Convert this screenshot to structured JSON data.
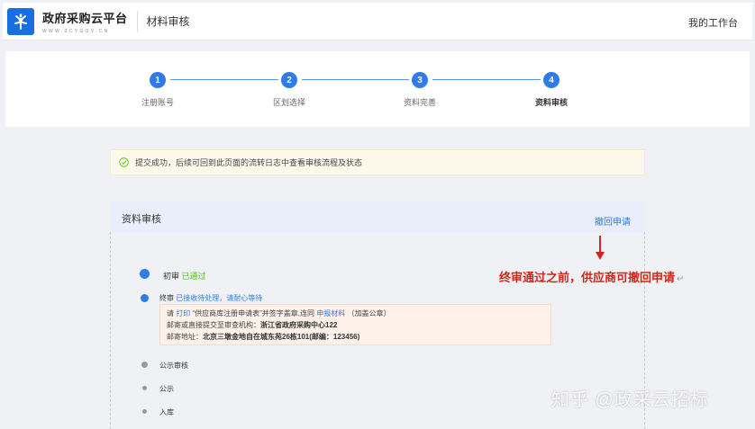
{
  "header": {
    "logo_title": "政府采购云平台",
    "logo_url": "WWW.ZCYGOV.CN",
    "section_title": "材料审核",
    "workbench_link": "我的工作台"
  },
  "steps": [
    {
      "number": "1",
      "label": "注册账号",
      "active": false
    },
    {
      "number": "2",
      "label": "区划选择",
      "active": false
    },
    {
      "number": "3",
      "label": "资料完善",
      "active": false
    },
    {
      "number": "4",
      "label": "资料审核",
      "active": true
    }
  ],
  "notice": {
    "text": "提交成功，后续可回到此页面的流转日志中查看审核流程及状态"
  },
  "review": {
    "title": "资料审核",
    "withdraw_label": "撤回申请",
    "timeline": [
      {
        "label": "初审",
        "status": "已通过",
        "status_color": "#52c41a"
      },
      {
        "label": "终审",
        "status": "已接收待处理，请耐心等待",
        "status_color": "#2f7ce6"
      },
      {
        "label": "公示审核"
      },
      {
        "label": "公示"
      },
      {
        "label": "入库"
      }
    ],
    "info": {
      "l1_a": "请",
      "l1_link1": "打印",
      "l1_b": "“供应商库注册申请表”并签字盖章,连同",
      "l1_link2": "申报材料",
      "l1_c": "（加盖公章）",
      "l2_a": "邮寄或直接提交至审查机构：",
      "l2_b": "浙江省政府采购中心122",
      "l3_a": "邮寄地址：",
      "l3_b": "北京三墩金地自在城东苑26栋101(邮编：123456)"
    }
  },
  "annotation": {
    "text": "终审通过之前，供应商可撤回申请",
    "mark": "↵"
  },
  "watermark": "知乎 @政采云招标",
  "colors": {
    "primary": "#2f7ce6",
    "success": "#52c41a",
    "annotation": "#d0271c"
  }
}
